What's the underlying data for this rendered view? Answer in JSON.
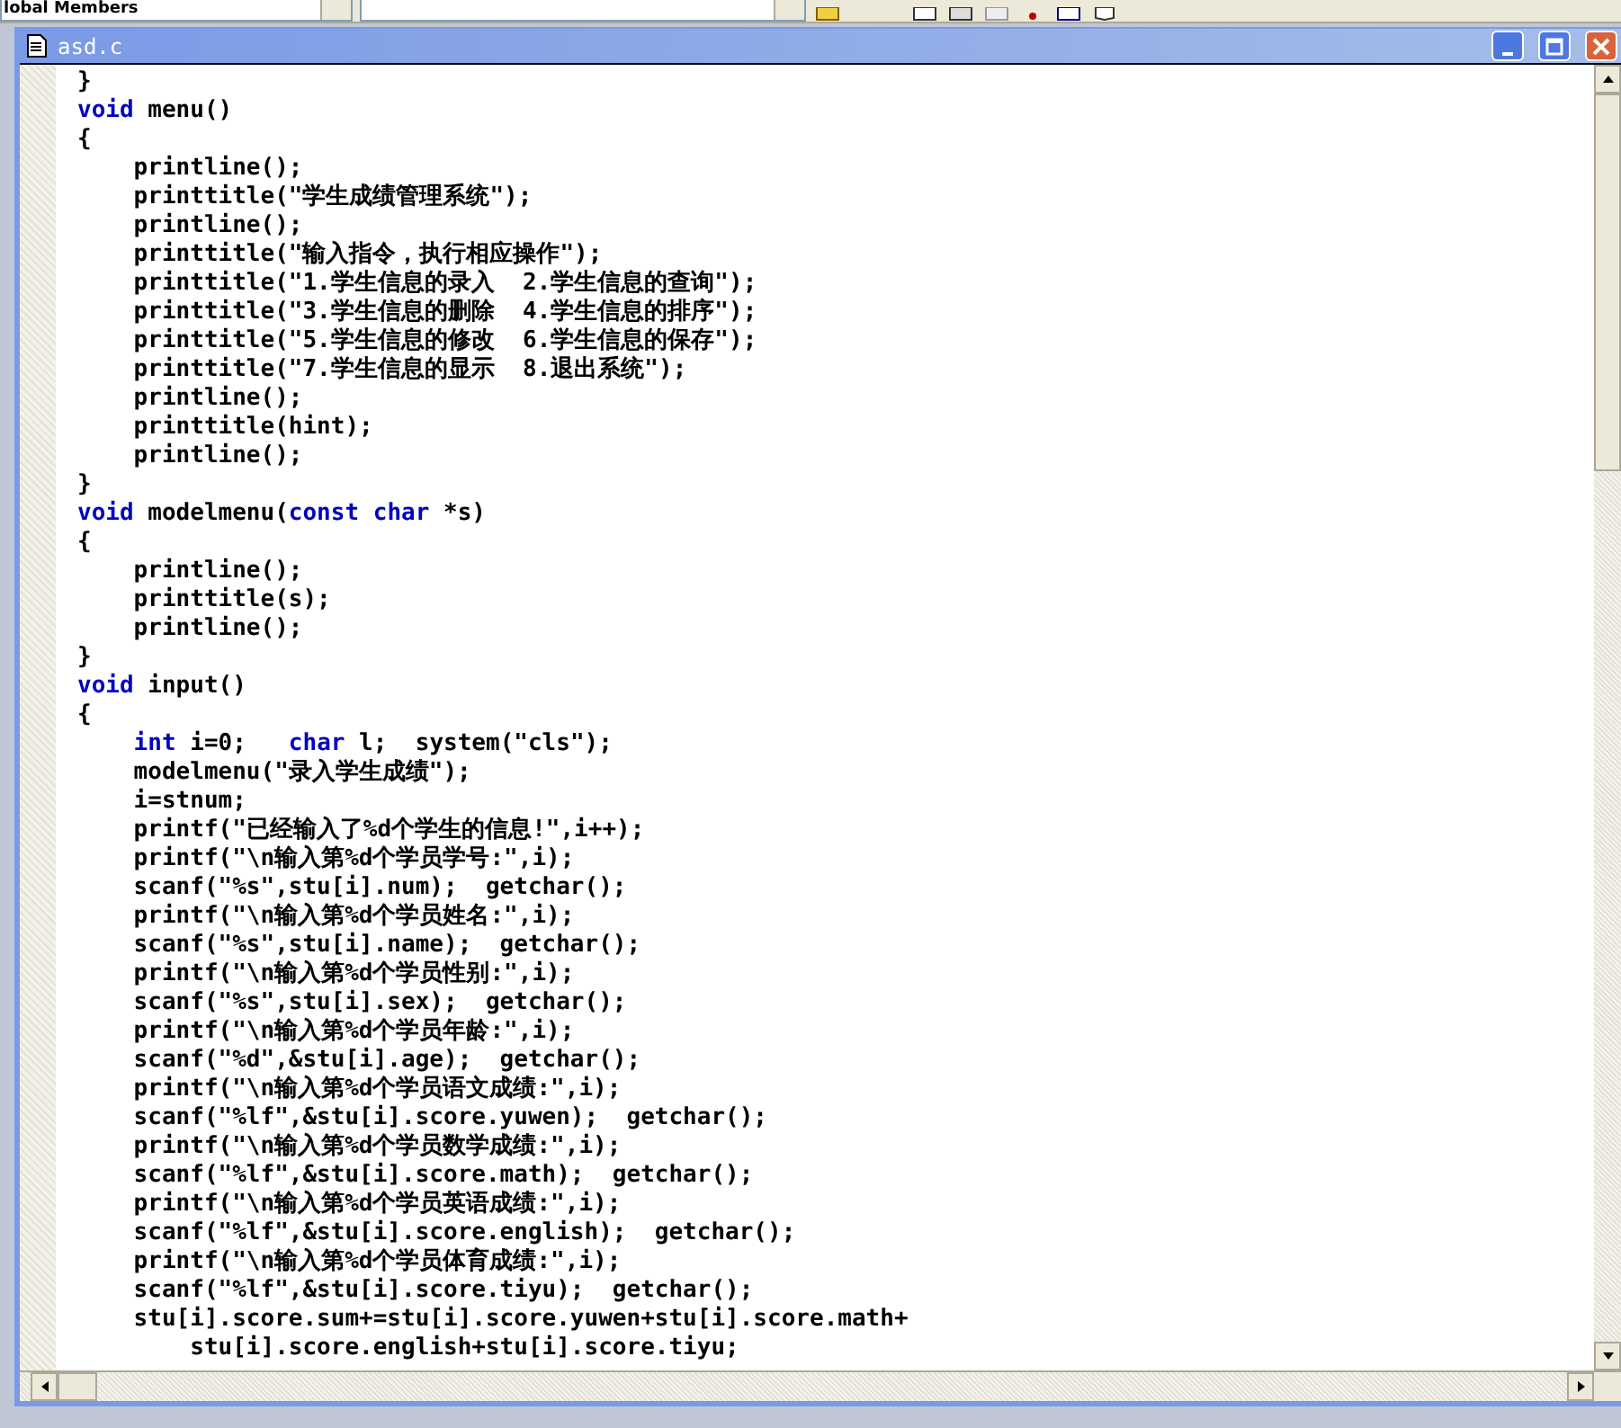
{
  "toolbar": {
    "combo_1": "lobal Members"
  },
  "window": {
    "title": "asd.c"
  },
  "code_lines": [
    [
      {
        "kind": "plain",
        "text": "}"
      }
    ],
    [
      {
        "kind": "keyword",
        "text": "void"
      },
      {
        "kind": "plain",
        "text": " menu()"
      }
    ],
    [
      {
        "kind": "plain",
        "text": "{"
      }
    ],
    [
      {
        "kind": "plain",
        "text": "    printline();"
      }
    ],
    [
      {
        "kind": "plain",
        "text": "    printtitle(\"学生成绩管理系统\");"
      }
    ],
    [
      {
        "kind": "plain",
        "text": "    printline();"
      }
    ],
    [
      {
        "kind": "plain",
        "text": "    printtitle(\"输入指令，执行相应操作\");"
      }
    ],
    [
      {
        "kind": "plain",
        "text": "    printtitle(\"1.学生信息的录入  2.学生信息的查询\");"
      }
    ],
    [
      {
        "kind": "plain",
        "text": "    printtitle(\"3.学生信息的删除  4.学生信息的排序\");"
      }
    ],
    [
      {
        "kind": "plain",
        "text": "    printtitle(\"5.学生信息的修改  6.学生信息的保存\");"
      }
    ],
    [
      {
        "kind": "plain",
        "text": "    printtitle(\"7.学生信息的显示  8.退出系统\");"
      }
    ],
    [
      {
        "kind": "plain",
        "text": "    printline();"
      }
    ],
    [
      {
        "kind": "plain",
        "text": "    printtitle(hint);"
      }
    ],
    [
      {
        "kind": "plain",
        "text": "    printline();"
      }
    ],
    [
      {
        "kind": "plain",
        "text": "}"
      }
    ],
    [
      {
        "kind": "keyword",
        "text": "void"
      },
      {
        "kind": "plain",
        "text": " modelmenu("
      },
      {
        "kind": "keyword",
        "text": "const char"
      },
      {
        "kind": "plain",
        "text": " *s)"
      }
    ],
    [
      {
        "kind": "plain",
        "text": "{"
      }
    ],
    [
      {
        "kind": "plain",
        "text": "    printline();"
      }
    ],
    [
      {
        "kind": "plain",
        "text": "    printtitle(s);"
      }
    ],
    [
      {
        "kind": "plain",
        "text": "    printline();"
      }
    ],
    [
      {
        "kind": "plain",
        "text": "}"
      }
    ],
    [
      {
        "kind": "keyword",
        "text": "void"
      },
      {
        "kind": "plain",
        "text": " input()"
      }
    ],
    [
      {
        "kind": "plain",
        "text": "{"
      }
    ],
    [
      {
        "kind": "keyword",
        "text": "    int"
      },
      {
        "kind": "plain",
        "text": " i=0;   "
      },
      {
        "kind": "keyword",
        "text": "char"
      },
      {
        "kind": "plain",
        "text": " l;  system(\"cls\");"
      }
    ],
    [
      {
        "kind": "plain",
        "text": "    modelmenu(\"录入学生成绩\");"
      }
    ],
    [
      {
        "kind": "plain",
        "text": "    i=stnum;"
      }
    ],
    [
      {
        "kind": "plain",
        "text": "    printf(\"已经输入了%d个学生的信息!\",i++);"
      }
    ],
    [
      {
        "kind": "plain",
        "text": "    printf(\"\\n输入第%d个学员学号:\",i);"
      }
    ],
    [
      {
        "kind": "plain",
        "text": "    scanf(\"%s\",stu[i].num);  getchar();"
      }
    ],
    [
      {
        "kind": "plain",
        "text": "    printf(\"\\n输入第%d个学员姓名:\",i);"
      }
    ],
    [
      {
        "kind": "plain",
        "text": "    scanf(\"%s\",stu[i].name);  getchar();"
      }
    ],
    [
      {
        "kind": "plain",
        "text": "    printf(\"\\n输入第%d个学员性别:\",i);"
      }
    ],
    [
      {
        "kind": "plain",
        "text": "    scanf(\"%s\",stu[i].sex);  getchar();"
      }
    ],
    [
      {
        "kind": "plain",
        "text": "    printf(\"\\n输入第%d个学员年龄:\",i);"
      }
    ],
    [
      {
        "kind": "plain",
        "text": "    scanf(\"%d\",&stu[i].age);  getchar();"
      }
    ],
    [
      {
        "kind": "plain",
        "text": "    printf(\"\\n输入第%d个学员语文成绩:\",i);"
      }
    ],
    [
      {
        "kind": "plain",
        "text": "    scanf(\"%lf\",&stu[i].score.yuwen);  getchar();"
      }
    ],
    [
      {
        "kind": "plain",
        "text": "    printf(\"\\n输入第%d个学员数学成绩:\",i);"
      }
    ],
    [
      {
        "kind": "plain",
        "text": "    scanf(\"%lf\",&stu[i].score.math);  getchar();"
      }
    ],
    [
      {
        "kind": "plain",
        "text": "    printf(\"\\n输入第%d个学员英语成绩:\",i);"
      }
    ],
    [
      {
        "kind": "plain",
        "text": "    scanf(\"%lf\",&stu[i].score.english);  getchar();"
      }
    ],
    [
      {
        "kind": "plain",
        "text": "    printf(\"\\n输入第%d个学员体育成绩:\",i);"
      }
    ],
    [
      {
        "kind": "plain",
        "text": "    scanf(\"%lf\",&stu[i].score.tiyu);  getchar();"
      }
    ],
    [
      {
        "kind": "plain",
        "text": "    stu[i].score.sum+=stu[i].score.yuwen+stu[i].score.math+"
      }
    ],
    [
      {
        "kind": "plain",
        "text": "        stu[i].score.english+stu[i].score.tiyu;"
      }
    ]
  ]
}
